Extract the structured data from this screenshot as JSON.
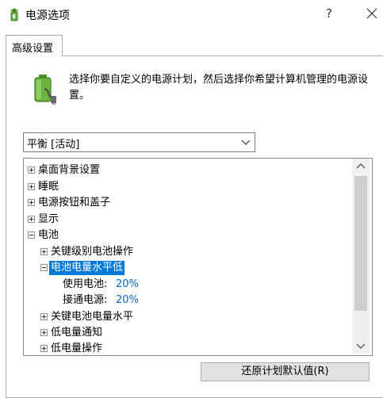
{
  "window": {
    "title": "电源选项",
    "help_label": "?",
    "title_icon": "power-options-icon",
    "close_icon": "close-icon"
  },
  "tabs": [
    {
      "label": "高级设置",
      "selected": true
    }
  ],
  "description": "选择你要自定义的电源计划，然后选择你希望计算机管理的电源设置。",
  "plan_select": {
    "value": "平衡 [活动]"
  },
  "tree": {
    "items": [
      {
        "label": "桌面背景设置",
        "state": "collapsed"
      },
      {
        "label": "睡眠",
        "state": "collapsed"
      },
      {
        "label": "电源按钮和盖子",
        "state": "collapsed"
      },
      {
        "label": "显示",
        "state": "collapsed"
      },
      {
        "label": "电池",
        "state": "expanded"
      },
      {
        "label": "关键级别电池操作",
        "state": "collapsed"
      },
      {
        "label": "电池电量水平低",
        "state": "expanded",
        "selected": true
      },
      {
        "label": "使用电池:",
        "value": "20%"
      },
      {
        "label": "接通电源:",
        "value": "20%"
      },
      {
        "label": "关键电池电量水平",
        "state": "collapsed"
      },
      {
        "label": "低电量通知",
        "state": "collapsed"
      },
      {
        "label": "低电量操作",
        "state": "collapsed"
      }
    ]
  },
  "restore_button": {
    "label": "还原计划默认值(R)"
  },
  "colors": {
    "selection": "#0078d7",
    "value_link": "#0066cc",
    "button_bg": "#e1e1e1"
  }
}
